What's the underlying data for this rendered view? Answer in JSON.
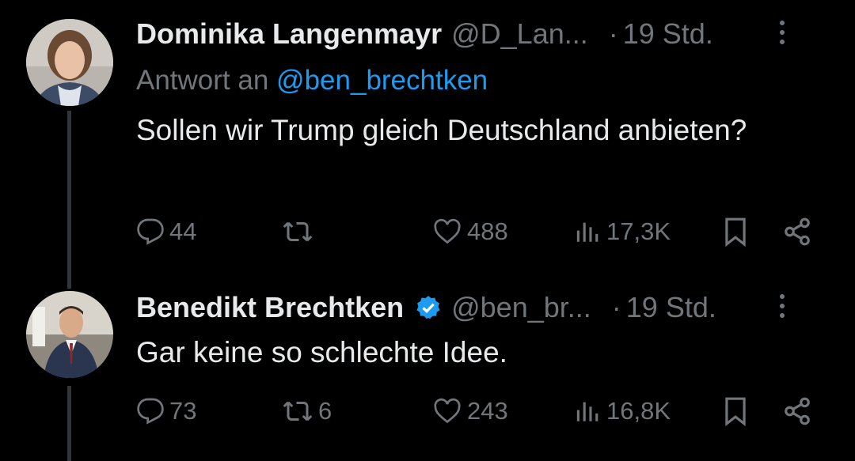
{
  "tweets": [
    {
      "name": "Dominika Langenmayr",
      "handle": "@D_Lan...",
      "time": "19 Std.",
      "separator": "·",
      "reply_prefix": "Antwort an",
      "reply_mention": "@ben_brechtken",
      "text": "Sollen wir Trump gleich Deutschland anbieten?",
      "replies": "44",
      "retweets": "",
      "likes": "488",
      "views": "17,3K",
      "verified": false
    },
    {
      "name": "Benedikt Brechtken",
      "handle": "@ben_br...",
      "time": "19 Std.",
      "separator": "·",
      "text": "Gar keine so schlechte Idee.",
      "replies": "73",
      "retweets": "6",
      "likes": "243",
      "views": "16,8K",
      "verified": true
    }
  ],
  "colors": {
    "background": "#000000",
    "text_primary": "#e7e9ea",
    "text_secondary": "#71767b",
    "link": "#1d9bf0",
    "verified": "#1d9bf0"
  }
}
